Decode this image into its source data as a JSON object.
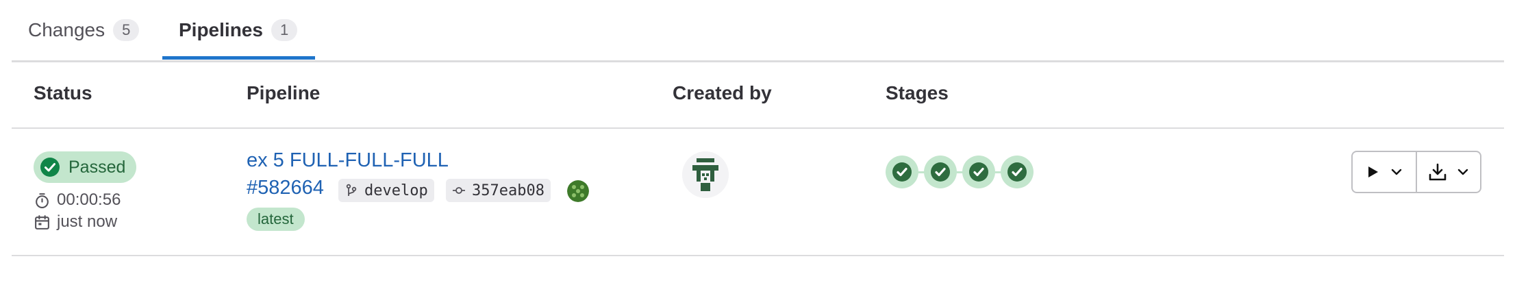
{
  "tabs": [
    {
      "label": "Changes",
      "count": "5"
    },
    {
      "label": "Pipelines",
      "count": "1"
    }
  ],
  "columns": {
    "status": "Status",
    "pipeline": "Pipeline",
    "created_by": "Created by",
    "stages": "Stages"
  },
  "pipeline_row": {
    "status": "Passed",
    "duration": "00:00:56",
    "finished": "just now",
    "name": "ex 5 FULL-FULL-FULL",
    "id": "#582664",
    "branch": "develop",
    "commit": "357eab08",
    "tag": "latest",
    "stages": [
      "passed",
      "passed",
      "passed",
      "passed"
    ]
  },
  "colors": {
    "accent": "#1f75cb",
    "success": "#108548",
    "success_bg": "#c3e6cd",
    "link": "#1f62b3"
  },
  "icons": {
    "status": "check-circle-icon",
    "duration": "timer-icon",
    "finished": "calendar-icon",
    "branch": "branch-icon",
    "commit": "commit-icon",
    "run": "play-icon",
    "artifacts": "download-icon",
    "dropdown": "chevron-down-icon"
  }
}
